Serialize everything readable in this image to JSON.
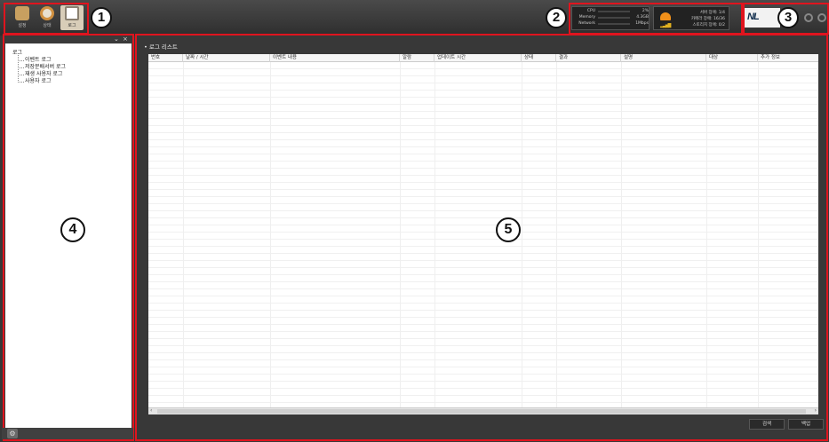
{
  "toolbar": {
    "buttons": [
      {
        "label": "설정",
        "icon": "camera-settings-icon",
        "color": "#c8a060"
      },
      {
        "label": "상태",
        "icon": "clock-status-icon",
        "color": "#d09040"
      },
      {
        "label": "로그",
        "icon": "magnifier-log-icon",
        "color": "#8a8070"
      }
    ]
  },
  "callouts": [
    "1",
    "2",
    "3",
    "4",
    "5"
  ],
  "system": {
    "rows": [
      {
        "name": "CPU",
        "value": "2%",
        "level": 0.02
      },
      {
        "name": "Memory",
        "value": "4.3GB",
        "level": 0.55
      },
      {
        "name": "Network",
        "value": "1Mbps",
        "level": 0.05
      }
    ]
  },
  "alarms": {
    "rows": [
      "서버 장애: 1/4",
      "카메라 장애: 16/36",
      "스토리지 장애: 0/2"
    ],
    "siren_icon": "siren-icon"
  },
  "logo": "NL",
  "tree": {
    "root": "로그",
    "children": [
      "이벤트 로그",
      "저장분배서버 로그",
      "재생 사용자 로그",
      "사용자 로그"
    ]
  },
  "left_panel": {
    "collapse_glyph": "⌄",
    "close_glyph": "×"
  },
  "main": {
    "list_title": "• 로그 리스트",
    "columns": [
      "번호",
      "날짜 / 시간",
      "이벤트 내용",
      "알람",
      "업데이트 시간",
      "상태",
      "결과",
      "설명",
      "대상",
      "추가 정보"
    ],
    "search_button": "검색",
    "backup_button": "백업"
  },
  "colors": {
    "accent_red": "#e0141e",
    "bg": "#383838"
  }
}
